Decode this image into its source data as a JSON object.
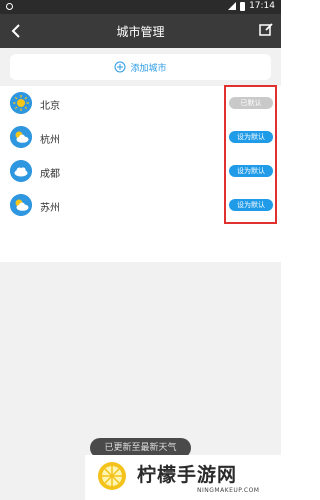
{
  "status_bar": {
    "time": "17:14"
  },
  "header": {
    "title": "城市管理"
  },
  "add_city": {
    "label": "添加城市"
  },
  "cities": [
    {
      "name": "北京",
      "weather_icon": "sun-icon",
      "button": "已默认",
      "is_default": true
    },
    {
      "name": "杭州",
      "weather_icon": "partly-cloudy-icon",
      "button": "设为默认",
      "is_default": false
    },
    {
      "name": "成都",
      "weather_icon": "cloud-icon",
      "button": "设为默认",
      "is_default": false
    },
    {
      "name": "苏州",
      "weather_icon": "partly-cloudy-icon",
      "button": "设为默认",
      "is_default": false
    }
  ],
  "toast": {
    "text": "已更新至最新天气"
  },
  "watermark": {
    "brand": "柠檬手游网",
    "url": "NINGMAKEUP.COM"
  },
  "colors": {
    "accent": "#1f9be8",
    "header": "#3a3a3a",
    "highlight": "#e03030"
  }
}
